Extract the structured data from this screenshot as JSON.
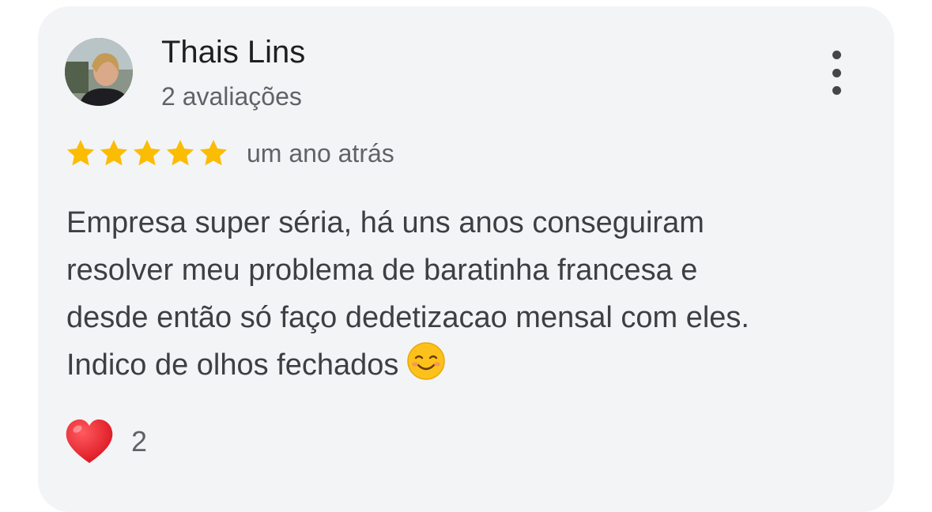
{
  "review": {
    "reviewer_name": "Thais Lins",
    "review_count": "2 avaliações",
    "rating": 5,
    "rating_max": 5,
    "time": "um ano atrás",
    "text": "Empresa super séria, há uns anos conseguiram\nresolver meu problema de baratinha francesa e\ndesde então só faço dedetizacao mensal com eles.\nIndico de olhos fechados",
    "text_emoji": "smiling-face-emoji",
    "reaction": {
      "icon": "heart-icon",
      "count": "2"
    }
  },
  "colors": {
    "card_background": "#f3f4f6",
    "star": "#fbbc04",
    "heart": "#e3202c",
    "name_text": "#1f1f1f",
    "secondary_text": "#5f6368",
    "body_text": "#3c4043"
  },
  "icons": {
    "menu": "more-vert-icon",
    "avatar": "avatar-photo",
    "star": "star-icon"
  }
}
